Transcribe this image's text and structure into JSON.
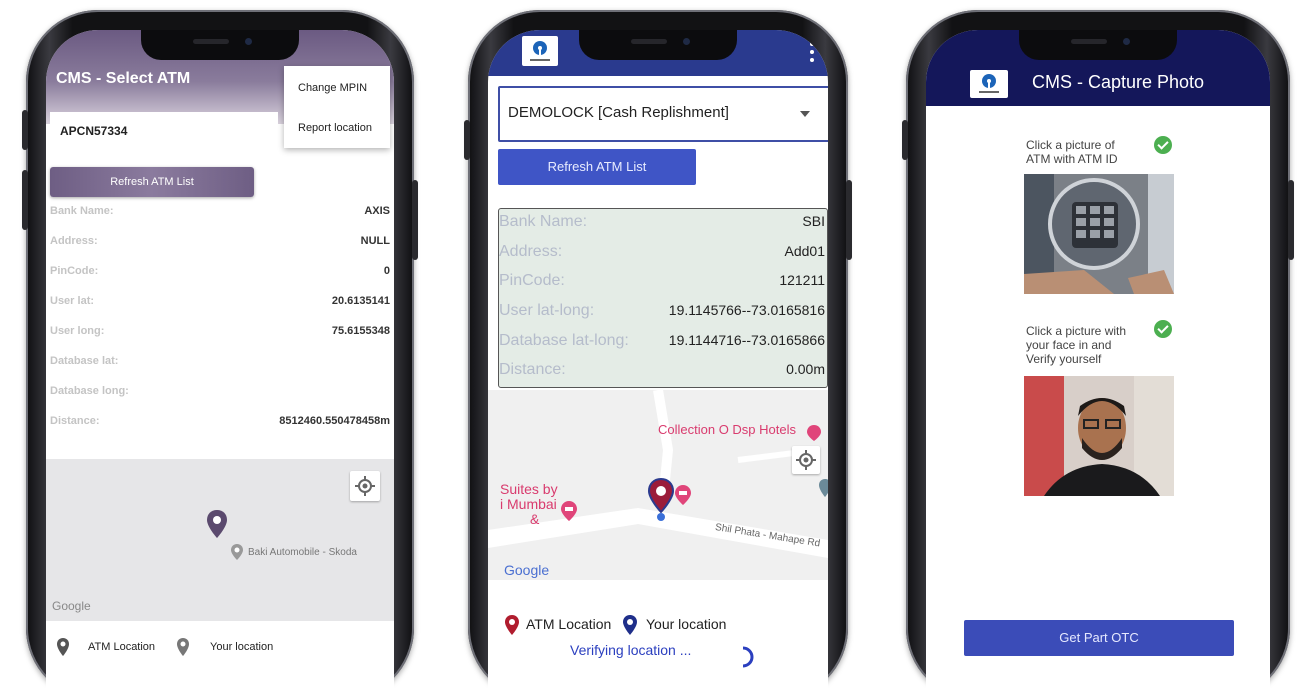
{
  "phone1": {
    "title": "CMS - Select ATM",
    "menu": {
      "change_mpin": "Change MPIN",
      "report_location": "Report location"
    },
    "atm_input_value": "APCN57334",
    "refresh_label": "Refresh ATM List",
    "details": [
      {
        "label": "Bank Name:",
        "value": "AXIS"
      },
      {
        "label": "Address:",
        "value": "NULL"
      },
      {
        "label": "PinCode:",
        "value": "0"
      },
      {
        "label": "User lat:",
        "value": "20.6135141"
      },
      {
        "label": "User long:",
        "value": "75.6155348"
      },
      {
        "label": "Database lat:",
        "value": ""
      },
      {
        "label": "Database long:",
        "value": ""
      },
      {
        "label": "Distance:",
        "value": "8512460.550478458m"
      }
    ],
    "map": {
      "place_label": "Baki Automobile - Skoda",
      "google": "Google"
    },
    "legend": {
      "atm": "ATM Location",
      "you": "Your location"
    }
  },
  "phone2": {
    "select_value": "DEMOLOCK [Cash Replishment]",
    "refresh_label": "Refresh ATM List",
    "details": [
      {
        "label": "Bank Name:",
        "value": "SBI"
      },
      {
        "label": "Address:",
        "value": "Add01"
      },
      {
        "label": "PinCode:",
        "value": "121211"
      },
      {
        "label": "User lat-long:",
        "value": "19.1145766--73.0165816"
      },
      {
        "label": "Database lat-long:",
        "value": "19.1144716--73.0165866"
      },
      {
        "label": "Distance:",
        "value": "0.00m"
      }
    ],
    "map": {
      "place1": "Collection O Dsp Hotels",
      "place2_line1": "Suites by",
      "place2_line2": "i Mumbai",
      "place2_line3": "&",
      "road": "Shil Phata - Mahape Rd",
      "google": "Google"
    },
    "legend": {
      "atm": "ATM Location",
      "you": "Your location"
    },
    "status": "Verifying location ..."
  },
  "phone3": {
    "title": "CMS - Capture Photo",
    "caption1": [
      "Click a picture of",
      "ATM with ATM ID"
    ],
    "caption2": [
      "Click a picture with",
      "your face in and",
      "Verify yourself"
    ],
    "otc_label": "Get Part OTC"
  }
}
